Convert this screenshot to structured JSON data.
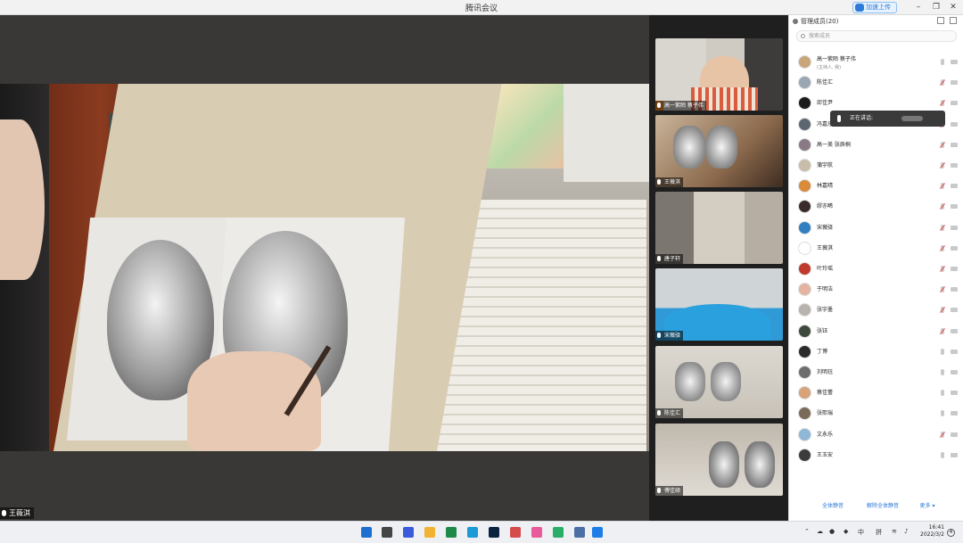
{
  "window": {
    "title": "腾讯会议",
    "upload_label": "加速上传"
  },
  "main_video": {
    "speaker_name": "王薇淇"
  },
  "thumbnails": [
    {
      "name": "高一紫陌 蔡子伟",
      "host": true
    },
    {
      "name": "王薇淇"
    },
    {
      "name": "唐子轩"
    },
    {
      "name": "宋薇驿"
    },
    {
      "name": "陈佳汇"
    },
    {
      "name": "傅佳硕"
    }
  ],
  "panel": {
    "title": "管理成员(20)",
    "search_placeholder": "搜索成员",
    "members": [
      {
        "name": "高一紫陌 蔡子伟",
        "sub": "(主持人, 我)",
        "avatar_color": "#c9a57c",
        "mic_off": false,
        "cam_off": false
      },
      {
        "name": "陈佳汇",
        "avatar_color": "#9aa6b2",
        "mic_off": true,
        "cam_off": false
      },
      {
        "name": "邱佳尹",
        "avatar_color": "#1b1b1b",
        "mic_off": true,
        "cam_off": false
      },
      {
        "name": "冯嘉乐",
        "avatar_color": "#5c6670",
        "mic_off": true,
        "cam_off": false
      },
      {
        "name": "高一美 张辰桐",
        "avatar_color": "#8a7a86",
        "mic_off": true,
        "cam_off": false
      },
      {
        "name": "蒲宇航",
        "avatar_color": "#c7bda8",
        "mic_off": true,
        "cam_off": false
      },
      {
        "name": "林嘉晴",
        "avatar_color": "#d98b3a",
        "mic_off": true,
        "cam_off": false
      },
      {
        "name": "缪亦晞",
        "avatar_color": "#3a2a2a",
        "mic_off": true,
        "cam_off": false
      },
      {
        "name": "宋薇驿",
        "avatar_color": "#2f7fc1",
        "mic_off": true,
        "cam_off": false
      },
      {
        "name": "王薇淇",
        "avatar_color": "#ffffff",
        "mic_off": true,
        "cam_off": false
      },
      {
        "name": "叶玲瑶",
        "avatar_color": "#c0392b",
        "mic_off": true,
        "cam_off": false
      },
      {
        "name": "于明洁",
        "avatar_color": "#e3b4a0",
        "mic_off": true,
        "cam_off": false
      },
      {
        "name": "张宇墨",
        "avatar_color": "#b9b3ad",
        "mic_off": true,
        "cam_off": false
      },
      {
        "name": "张钰",
        "avatar_color": "#3d4a3d",
        "mic_off": true,
        "cam_off": false
      },
      {
        "name": "丁博",
        "avatar_color": "#2b2b2b",
        "mic_off": false,
        "cam_off": false
      },
      {
        "name": "刘明珏",
        "avatar_color": "#6d6d6d",
        "mic_off": false,
        "cam_off": false
      },
      {
        "name": "蔡佳蕾",
        "avatar_color": "#d8a27a",
        "mic_off": false,
        "cam_off": false
      },
      {
        "name": "张熙瑞",
        "avatar_color": "#7a6a58",
        "mic_off": false,
        "cam_off": false
      },
      {
        "name": "文永乐",
        "avatar_color": "#8fb7d6",
        "mic_off": true,
        "cam_off": false
      },
      {
        "name": "王玉安",
        "avatar_color": "#3c3c3c",
        "mic_off": false,
        "cam_off": false
      }
    ],
    "speaking_label": "正在讲话:",
    "footer": {
      "mute_all": "全体静音",
      "unmute_all": "解除全体静音",
      "more": "更多 ▾"
    }
  },
  "taskbar": {
    "ime_lang": "中",
    "ime_mode": "拼",
    "time": "16:41",
    "date": "2022/3/2",
    "notifications": "4"
  }
}
